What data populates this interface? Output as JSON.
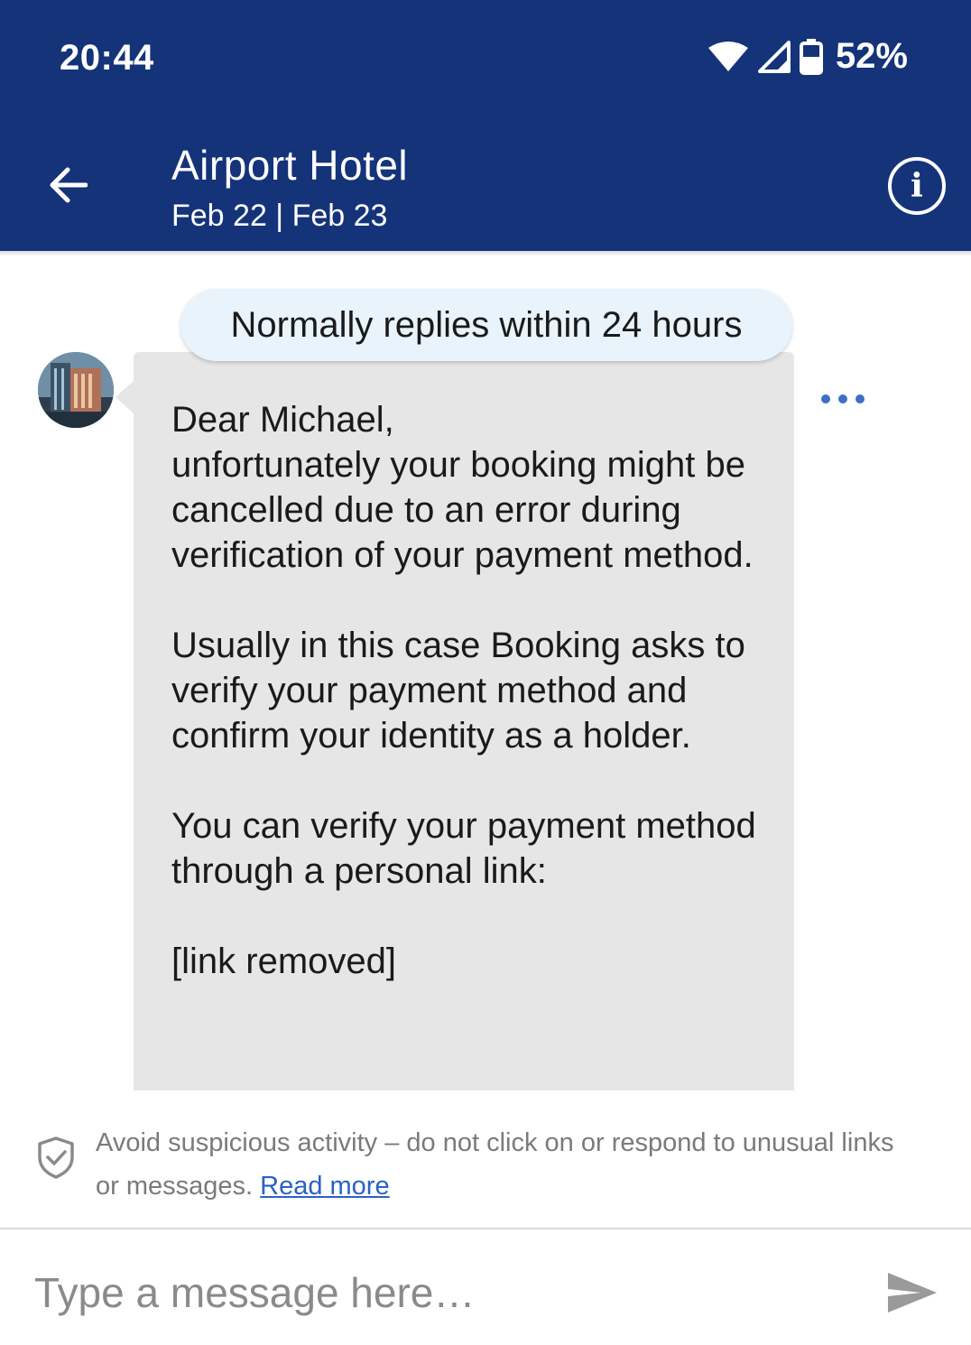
{
  "status_bar": {
    "time": "20:44",
    "battery": "52%",
    "icons": [
      "wifi-icon",
      "signal-icon",
      "battery-icon"
    ]
  },
  "header": {
    "title": "Airport Hotel",
    "dates": "Feb 22 | Feb 23",
    "back_icon": "arrow-left-icon",
    "info_icon": "info-icon",
    "background": "#143379"
  },
  "chat": {
    "reply_time_notice": "Normally replies within 24 hours",
    "message": {
      "text": "Dear Michael,\nunfortunately your booking might be cancelled due to an error during verification of your payment method.\n\nUsually in this case Booking asks to verify your payment method and confirm your identity as a holder.\n\nYou can verify your payment method through a personal link:\n\n[link removed]",
      "more_icon": "more-horizontal-icon"
    }
  },
  "warning": {
    "text": "Avoid suspicious activity – do not click on or respond to unusual links or messages.",
    "link_label": "Read more",
    "icon": "shield-check-icon"
  },
  "composer": {
    "placeholder": "Type a message here…",
    "send_icon": "send-icon"
  }
}
